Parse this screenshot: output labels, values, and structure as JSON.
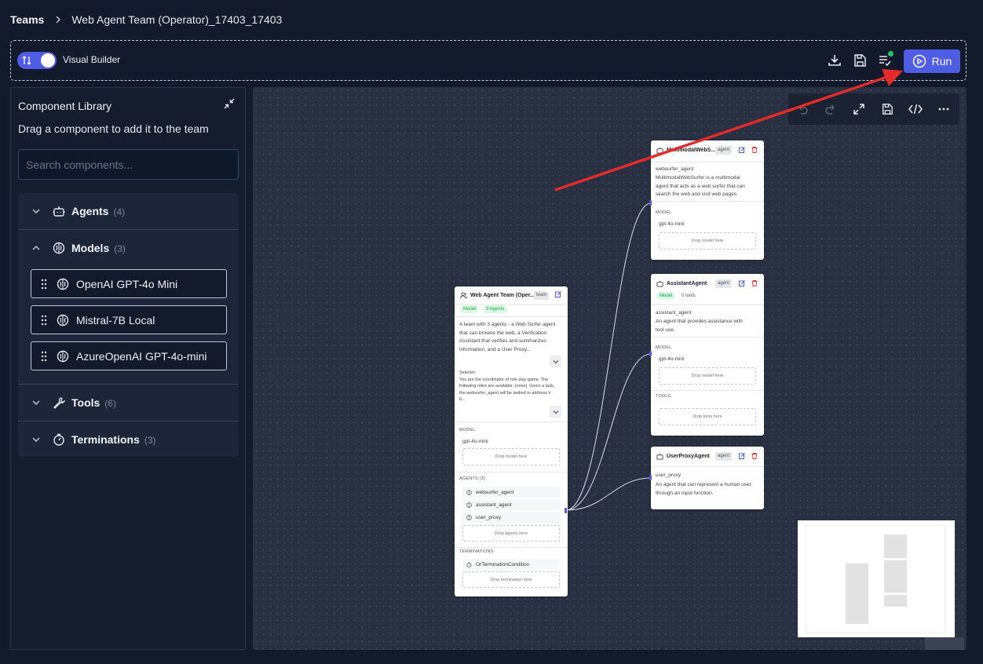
{
  "breadcrumb": {
    "root": "Teams",
    "current": "Web Agent Team (Operator)_17403_17403"
  },
  "toolbar": {
    "builder_label": "Visual Builder",
    "run_label": "Run",
    "colors": {
      "accent": "#4f5de4",
      "status_dot": "#22c55e"
    }
  },
  "sidebar": {
    "title": "Component Library",
    "subtitle": "Drag a component to add it to the team",
    "search_placeholder": "Search components...",
    "categories": [
      {
        "label": "Agents",
        "count": "(4)",
        "icon": "robot-icon",
        "expanded": false
      },
      {
        "label": "Models",
        "count": "(3)",
        "icon": "brain-icon",
        "expanded": true,
        "items": [
          "OpenAI GPT-4o Mini",
          "Mistral-7B Local",
          "AzureOpenAI GPT-4o-mini"
        ]
      },
      {
        "label": "Tools",
        "count": "(6)",
        "icon": "wrench-icon",
        "expanded": false
      },
      {
        "label": "Terminations",
        "count": "(3)",
        "icon": "timer-icon",
        "expanded": false
      }
    ]
  },
  "canvas": {
    "team_node": {
      "title": "Web Agent Team (Oper...",
      "badge": "team",
      "pills": [
        "Model",
        "3 Agents"
      ],
      "description": [
        "A team with 3 agents - a Web Surfer agent",
        "that can browse the web, a Verification",
        "Assistant that verifies and summarizes",
        "information, and a User Proxy..."
      ],
      "selector_label": "Selector",
      "selector_text": [
        "You are the coordinator of role play game. The",
        "following roles are available: {roles}. Given a task,",
        "the websurfer_agent will be tasked to address it",
        "b..."
      ],
      "model_section": "MODEL",
      "model_value": "gpt-4o-mini",
      "drop_model": "Drop model here",
      "agents_section": "AGENTS (3)",
      "agents": [
        "websurfer_agent",
        "assistant_agent",
        "user_proxy"
      ],
      "drop_agents": "Drop agents here",
      "terminations_section": "TERMINATIONS",
      "termination": "OrTerminationCondition",
      "drop_termination": "Drop termination here"
    },
    "agent_nodes": [
      {
        "title": "MultimodalWebS...",
        "badge": "agent",
        "name": "websurfer_agent",
        "description": [
          "MultimodalWebSurfer is a multimodal",
          "agent that acts as a web surfer that can",
          "search the web and visit web pages."
        ],
        "model_section": "MODEL",
        "model_value": "gpt-4o-mini",
        "drop_model": "Drop model here"
      },
      {
        "title": "AssistantAgent",
        "badge": "agent",
        "pills": [
          "Model",
          "0 tools"
        ],
        "name": "assistant_agent",
        "description": [
          "An agent that provides assistance with",
          "tool use."
        ],
        "model_section": "MODEL",
        "model_value": "gpt-4o-mini",
        "drop_model": "Drop model here",
        "tools_section": "TOOLS",
        "drop_tools": "Drop tools here"
      },
      {
        "title": "UserProxyAgent",
        "badge": "agent",
        "name": "user_proxy",
        "description": [
          "An agent that can represent a human user",
          "through an input function."
        ]
      }
    ]
  }
}
